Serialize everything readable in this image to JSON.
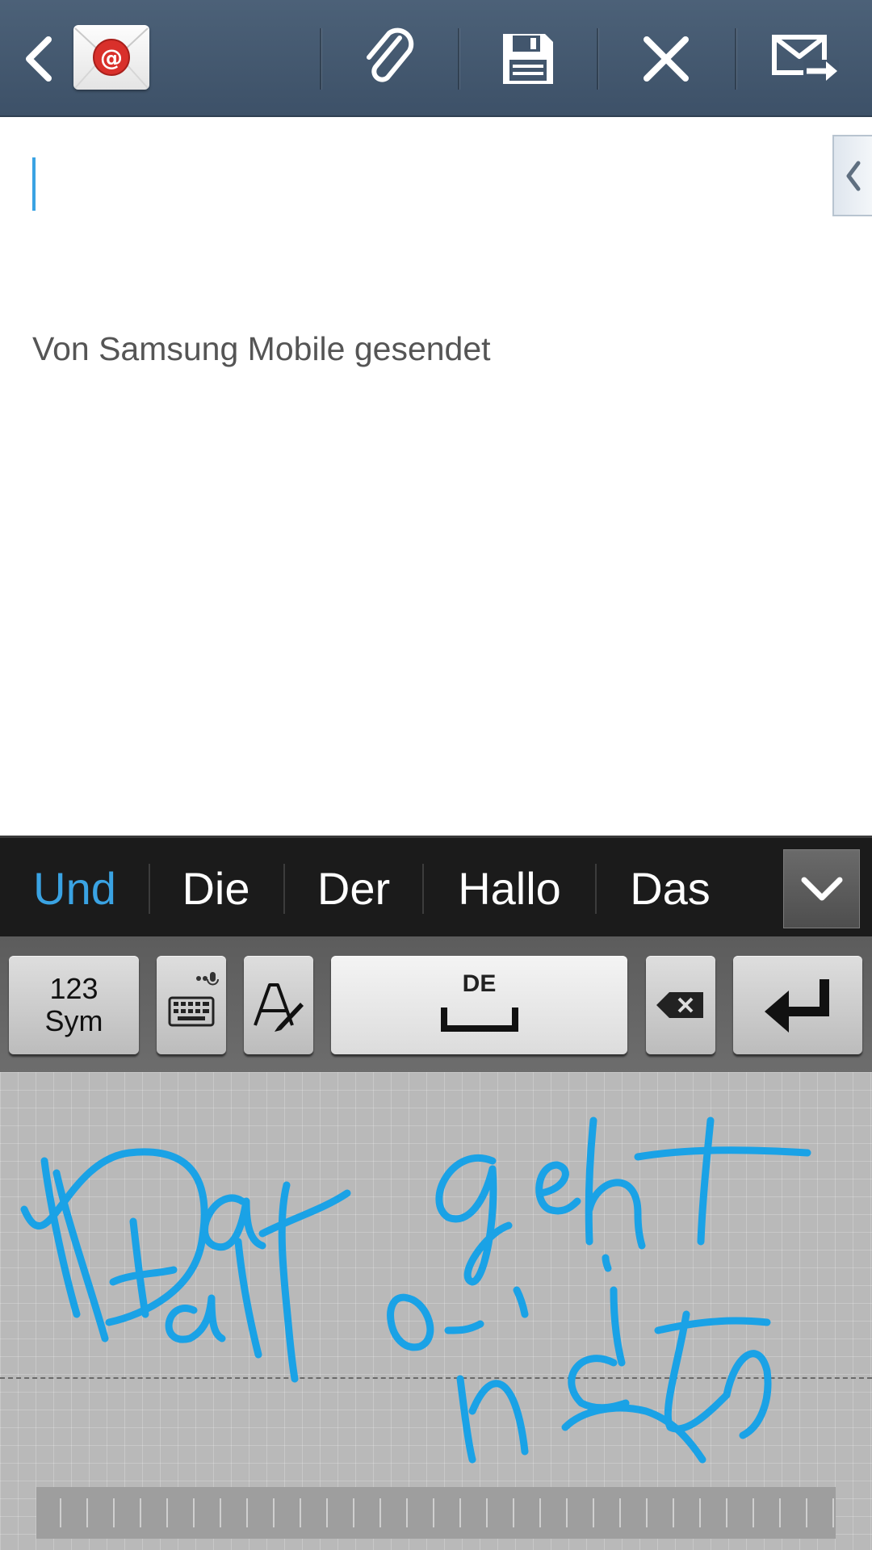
{
  "compose": {
    "signature": "Von Samsung Mobile gesendet",
    "body_value": ""
  },
  "actionbar": {
    "icons": [
      "back-icon",
      "email-app-icon",
      "attach-icon",
      "save-icon",
      "close-icon",
      "send-icon"
    ],
    "app_icon_glyph": "@",
    "colors": {
      "bar": "#42566d",
      "app_badge": "#d9302b"
    }
  },
  "suggestions": {
    "items": [
      "Und",
      "Die",
      "Der",
      "Hallo",
      "Das"
    ],
    "active_index": 0,
    "accent": "#3aa3e3"
  },
  "keyboard": {
    "sym_line1": "123",
    "sym_line2": "Sym",
    "space_language": "DE"
  },
  "handwriting": {
    "ink_color": "#1aa2e6"
  }
}
